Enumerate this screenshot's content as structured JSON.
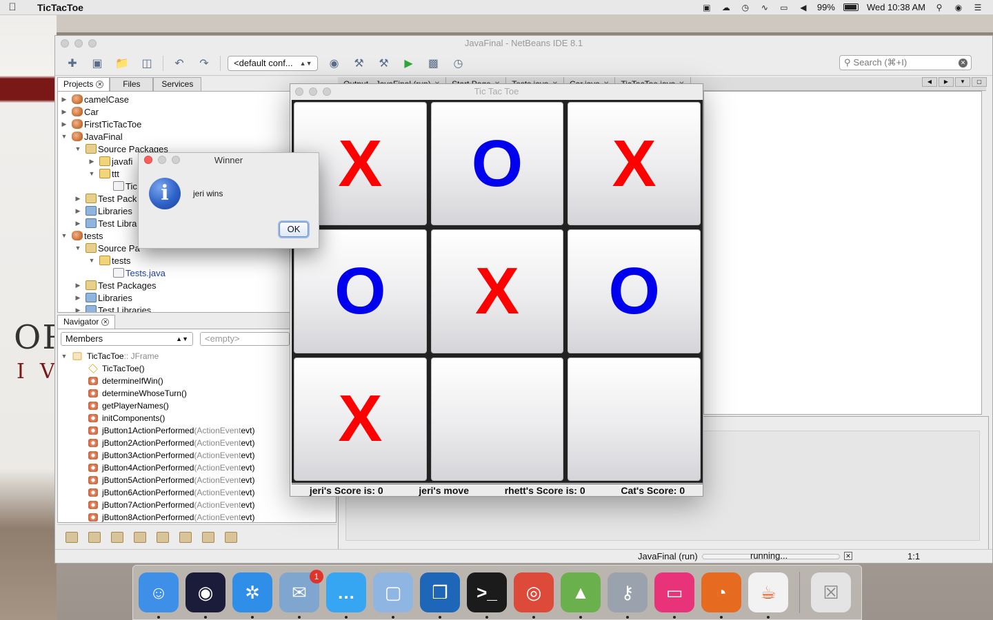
{
  "menubar": {
    "app_name": "TicTacToe",
    "battery": "99%",
    "clock": "Wed 10:38 AM"
  },
  "netbeans": {
    "title": "JavaFinal - NetBeans IDE 8.1",
    "config": "<default conf...",
    "search_placeholder": "Search (⌘+I)",
    "panel_tabs": [
      "Projects",
      "Files",
      "Services"
    ],
    "tree": [
      {
        "label": "camelCase",
        "indent": 0,
        "tri": "▶",
        "icon": "proj"
      },
      {
        "label": "Car",
        "indent": 0,
        "tri": "▶",
        "icon": "proj"
      },
      {
        "label": "FirstTicTacToe",
        "indent": 0,
        "tri": "▶",
        "icon": "proj"
      },
      {
        "label": "JavaFinal",
        "indent": 0,
        "tri": "▼",
        "icon": "proj"
      },
      {
        "label": "Source Packages",
        "indent": 1,
        "tri": "▼",
        "icon": "pkgs"
      },
      {
        "label": "javafi",
        "indent": 2,
        "tri": "▶",
        "icon": "pkg"
      },
      {
        "label": "ttt",
        "indent": 2,
        "tri": "▼",
        "icon": "pkg"
      },
      {
        "label": "Tic",
        "indent": 3,
        "tri": "",
        "icon": "file"
      },
      {
        "label": "Test Pack",
        "indent": 1,
        "tri": "▶",
        "icon": "pkgs"
      },
      {
        "label": "Libraries",
        "indent": 1,
        "tri": "▶",
        "icon": "lib"
      },
      {
        "label": "Test Libra",
        "indent": 1,
        "tri": "▶",
        "icon": "lib"
      },
      {
        "label": "tests",
        "indent": 0,
        "tri": "▼",
        "icon": "proj"
      },
      {
        "label": "Source Pa",
        "indent": 1,
        "tri": "▼",
        "icon": "pkgs"
      },
      {
        "label": "tests",
        "indent": 2,
        "tri": "▼",
        "icon": "pkg"
      },
      {
        "label": "Tests.java",
        "indent": 3,
        "tri": "",
        "icon": "file",
        "blue": true
      },
      {
        "label": "Test Packages",
        "indent": 1,
        "tri": "▶",
        "icon": "pkgs"
      },
      {
        "label": "Libraries",
        "indent": 1,
        "tri": "▶",
        "icon": "lib"
      },
      {
        "label": "Test Libraries",
        "indent": 1,
        "tri": "▶",
        "icon": "lib"
      }
    ],
    "navigator": {
      "tab": "Navigator",
      "members_combo": "Members",
      "filter_combo": "<empty>",
      "root_name": "TicTacToe",
      "root_type": " :: JFrame",
      "members": [
        {
          "name": "TicTacToe()",
          "args": "",
          "kind": "ctor"
        },
        {
          "name": "determineIfWin()",
          "args": "",
          "kind": "method"
        },
        {
          "name": "determineWhoseTurn()",
          "args": "",
          "kind": "method"
        },
        {
          "name": "getPlayerNames()",
          "args": "",
          "kind": "method"
        },
        {
          "name": "initComponents()",
          "args": "",
          "kind": "method"
        },
        {
          "name": "jButton1ActionPerformed",
          "args": "(ActionEvent",
          "tail": " evt)",
          "kind": "method"
        },
        {
          "name": "jButton2ActionPerformed",
          "args": "(ActionEvent",
          "tail": " evt)",
          "kind": "method"
        },
        {
          "name": "jButton3ActionPerformed",
          "args": "(ActionEvent",
          "tail": " evt)",
          "kind": "method"
        },
        {
          "name": "jButton4ActionPerformed",
          "args": "(ActionEvent",
          "tail": " evt)",
          "kind": "method"
        },
        {
          "name": "jButton5ActionPerformed",
          "args": "(ActionEvent",
          "tail": " evt)",
          "kind": "method"
        },
        {
          "name": "jButton6ActionPerformed",
          "args": "(ActionEvent",
          "tail": " evt)",
          "kind": "method"
        },
        {
          "name": "jButton7ActionPerformed",
          "args": "(ActionEvent",
          "tail": " evt)",
          "kind": "method"
        },
        {
          "name": "jButton8ActionPerformed",
          "args": "(ActionEvent",
          "tail": " evt)",
          "kind": "method"
        }
      ]
    },
    "editor_tabs": [
      "Output - JavaFinal (run)",
      "Start Page",
      "Tests.java",
      "Car.java",
      "TicTacToe.java"
    ],
    "status": {
      "run": "JavaFinal (run)",
      "progress": "running...",
      "position": "1:1"
    }
  },
  "tictactoe": {
    "title": "Tic Tac Toe",
    "cells": [
      "X",
      "O",
      "X",
      "O",
      "X",
      "O",
      "X",
      "",
      ""
    ],
    "score_p1": "jeri's Score is: 0",
    "turn": "jeri's move",
    "score_p2": "rhett's Score is: 0",
    "score_cat": "Cat's Score: 0"
  },
  "dialog": {
    "title": "Winner",
    "message": "jeri wins",
    "ok_label": "OK",
    "icon_glyph": "i"
  },
  "dock": {
    "apps": [
      {
        "name": "finder-icon",
        "color": "#3d8fe8",
        "glyph": "☺"
      },
      {
        "name": "siri-icon",
        "color": "#1b1b3a",
        "glyph": "◉"
      },
      {
        "name": "safari-icon",
        "color": "#2f8fe8",
        "glyph": "✲"
      },
      {
        "name": "mail-icon",
        "color": "#7ea6cf",
        "glyph": "✉",
        "badge": "1"
      },
      {
        "name": "messages-icon",
        "color": "#36a6f3",
        "glyph": "…"
      },
      {
        "name": "virtualbox-icon",
        "color": "#8fb5e3",
        "glyph": "▢"
      },
      {
        "name": "cisco-icon",
        "color": "#1e66b8",
        "glyph": "❒"
      },
      {
        "name": "terminal-icon",
        "color": "#1b1b1b",
        "glyph": ">_"
      },
      {
        "name": "chrome-icon",
        "color": "#dd4a3a",
        "glyph": "◎"
      },
      {
        "name": "android-studio-icon",
        "color": "#6ab04c",
        "glyph": "▲"
      },
      {
        "name": "keychain-icon",
        "color": "#9aa3ad",
        "glyph": "⚷"
      },
      {
        "name": "cleanmymac-icon",
        "color": "#e8327a",
        "glyph": "▭"
      },
      {
        "name": "firefox-icon",
        "color": "#e66a1f",
        "glyph": "◔"
      },
      {
        "name": "java-icon",
        "color": "#f2f2f2",
        "glyph": "☕"
      }
    ],
    "trash": {
      "name": "trash-icon",
      "color": "#e4e4e4",
      "glyph": "☒"
    }
  }
}
